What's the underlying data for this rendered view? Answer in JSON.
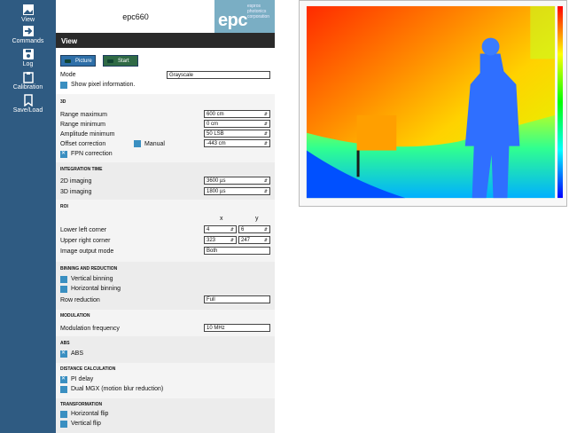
{
  "nav": {
    "items": [
      {
        "label": "View",
        "icon": "image-icon"
      },
      {
        "label": "Commands",
        "icon": "arrow-right-icon"
      },
      {
        "label": "Log",
        "icon": "floppy-icon"
      },
      {
        "label": "Calibration",
        "icon": "clipboard-icon"
      },
      {
        "label": "Save/Load",
        "icon": "bookmark-icon"
      }
    ]
  },
  "header": {
    "device": "epc660",
    "logo": "epc",
    "logo_sub": [
      "espros",
      "photonics",
      "corporation"
    ]
  },
  "viewbar": {
    "title": "View"
  },
  "buttons": {
    "picture": "Picture",
    "start": "Start"
  },
  "mode": {
    "label": "Mode",
    "value": "Grayscale",
    "show_pixel": "Show pixel information."
  },
  "section3d": {
    "title": "3D",
    "range_max": {
      "label": "Range maximum",
      "value": "600 cm"
    },
    "range_min": {
      "label": "Range minimum",
      "value": "0 cm"
    },
    "amp_min": {
      "label": "Amplitude minimum",
      "value": "50 LSB"
    },
    "offset": {
      "label": "Offset correction",
      "manual": "Manual",
      "value": "-443 cm"
    },
    "fpn": "FPN correction"
  },
  "integration": {
    "title": "INTEGRATION TIME",
    "t2d": {
      "label": "2D imaging",
      "value": "3600 µs"
    },
    "t3d": {
      "label": "3D imaging",
      "value": "1800 µs"
    }
  },
  "roi": {
    "title": "ROI",
    "x": "x",
    "y": "y",
    "lower": {
      "label": "Lower left corner",
      "x": "4",
      "y": "6"
    },
    "upper": {
      "label": "Upper right corner",
      "x": "323",
      "y": "247"
    },
    "output": {
      "label": "Image output mode",
      "value": "Both"
    }
  },
  "binning": {
    "title": "BINNING AND REDUCTION",
    "vertical": "Vertical binning",
    "horizontal": "Horizontal binning",
    "row": {
      "label": "Row reduction",
      "value": "Full"
    }
  },
  "modulation": {
    "title": "MODULATION",
    "label": "Modulation frequency",
    "value": "10 MHz"
  },
  "abs": {
    "title": "ABS",
    "label": "ABS"
  },
  "distance": {
    "title": "DISTANCE CALCULATION",
    "pi": "PI delay",
    "dual": "Dual MGX (motion blur reduction)"
  },
  "transform": {
    "title": "TRANSFORMATION",
    "hflip": "Horizontal flip",
    "vflip": "Vertical flip"
  },
  "colors": {
    "nav": "#2f5b82",
    "checkbox": "#3a8fc1",
    "picture_btn": "#2e6fa8",
    "start_btn": "#2f6a45"
  }
}
